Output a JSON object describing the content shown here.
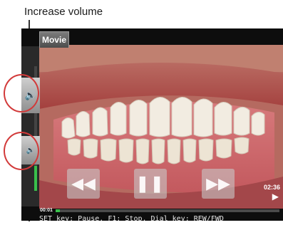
{
  "callout": {
    "label": "Increase volume"
  },
  "player": {
    "tab_label": "Movie",
    "elapsed": "00:01",
    "duration": "02:36",
    "progress": 0.02,
    "volume": 0.2,
    "status_text": "SET key: Pause, F1: Stop, Dial key: REW/FWD"
  },
  "controls": {
    "rewind_icon": "rewind-icon",
    "pause_icon": "pause-icon",
    "forward_icon": "fast-forward-icon"
  },
  "volume": {
    "up_icon": "volume-up-icon",
    "down_icon": "volume-down-icon"
  },
  "colors": {
    "highlight": "#d23a3a",
    "progress_green": "#39c04b"
  }
}
